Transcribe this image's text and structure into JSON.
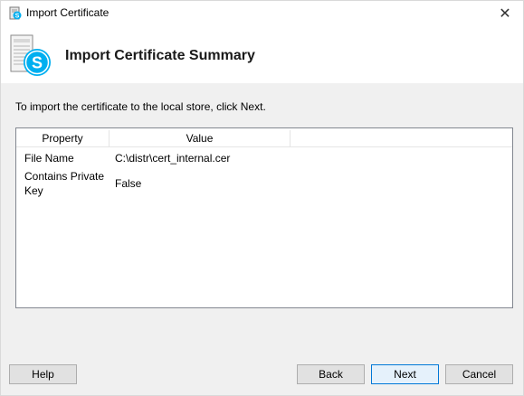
{
  "window": {
    "title": "Import Certificate",
    "close_glyph": "✕"
  },
  "header": {
    "title": "Import Certificate Summary",
    "icon": "certificate-skype-icon"
  },
  "instruction": "To import the certificate to the local store, click Next.",
  "table": {
    "columns": [
      "Property",
      "Value"
    ],
    "rows": [
      {
        "property": "File Name",
        "value": "C:\\distr\\cert_internal.cer"
      },
      {
        "property_line1": "Contains Private",
        "property_line2": "Key",
        "value": "False"
      }
    ]
  },
  "buttons": {
    "help": "Help",
    "back": "Back",
    "next": "Next",
    "cancel": "Cancel"
  },
  "colors": {
    "accent": "#0078d7",
    "skype_blue": "#00aff0"
  }
}
